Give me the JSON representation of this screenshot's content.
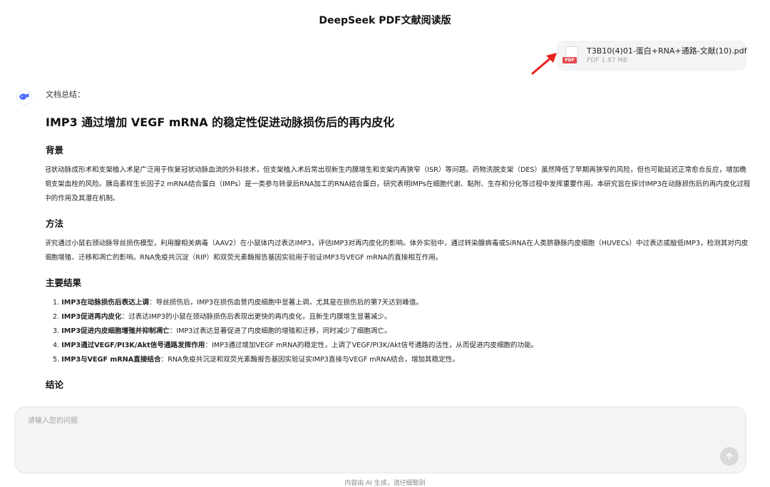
{
  "app": {
    "title": "DeepSeek PDF文献阅读版"
  },
  "file": {
    "name": "T3B10(4)01-蛋白+RNA+通路-文献(10).pdf",
    "size": "PDF 1.87 MB",
    "type_tag": "PDF",
    "icon": "pdf-file-icon"
  },
  "annotation": {
    "icon": "red-arrow-icon",
    "color": "#e8231d"
  },
  "assistant": {
    "avatar_icon": "deepseek-whale-icon",
    "label": "文档总结：",
    "accent": "#4d6bfe"
  },
  "summary": {
    "title": "IMP3 通过增加 VEGF mRNA 的稳定性促进动脉损伤后的再内皮化",
    "background": {
      "heading": "背景",
      "text": "冠状动脉成形术和支架植入术是广泛用于恢复冠状动脉血流的外科技术，但支架植入术后常出现新生内膜增生和支架内再狭窄（ISR）等问题。药物洗脱支架（DES）虽然降低了早期再狭窄的风险，但也可能延迟正常愈合反应，增加晚期支架血栓的风险。胰岛素样生长因子2 mRNA结合蛋白（IMPs）是一类参与转录后RNA加工的RNA结合蛋白，研究表明IMPs在细胞代谢、黏附、生存和分化等过程中发挥重要作用。本研究旨在探讨IMP3在动脉损伤后的再内皮化过程中的作用及其潜在机制。"
    },
    "methods": {
      "heading": "方法",
      "text": "研究通过小鼠右颈动脉导丝损伤模型，利用腺相关病毒（AAV2）在小鼠体内过表达IMP3，评估IMP3对再内皮化的影响。体外实验中，通过转染腺病毒或SiRNA在人类脐静脉内皮细胞（HUVECs）中过表达或敲低IMP3，检测其对内皮细胞增殖、迁移和凋亡的影响。RNA免疫共沉淀（RIP）和双荧光素酶报告基因实验用于验证IMP3与VEGF mRNA的直接相互作用。"
    },
    "results": {
      "heading": "主要结果",
      "items": [
        {
          "num": "1.",
          "bold": "IMP3在动脉损伤后表达上调",
          "text": "：导丝损伤后，IMP3在损伤血管内皮细胞中显著上调，尤其是在损伤后的第7天达到峰值。"
        },
        {
          "num": "2.",
          "bold": "IMP3促进再内皮化",
          "text": "：过表达IMP3的小鼠在颈动脉损伤后表现出更快的再内皮化，且新生内膜增生显著减少。"
        },
        {
          "num": "3.",
          "bold": "IMP3促进内皮细胞增殖并抑制凋亡",
          "text": "：IMP3过表达显著促进了内皮细胞的增殖和迁移，同时减少了细胞凋亡。"
        },
        {
          "num": "4.",
          "bold": "IMP3通过VEGF/PI3K/Akt信号通路发挥作用",
          "text": "：IMP3通过增加VEGF mRNA的稳定性，上调了VEGF/PI3K/Akt信号通路的活性，从而促进内皮细胞的功能。"
        },
        {
          "num": "5.",
          "bold": "IMP3与VEGF mRNA直接结合",
          "text": "：RNA免疫共沉淀和双荧光素酶报告基因实验证实IMP3直接与VEGF mRNA结合，增加其稳定性。"
        }
      ]
    },
    "conclusion": {
      "heading": "结论"
    }
  },
  "input": {
    "placeholder": "请输入您的问题",
    "value": "",
    "send_icon": "arrow-up-icon"
  },
  "footer": {
    "note": "内容由 AI 生成，请仔细甄别"
  }
}
